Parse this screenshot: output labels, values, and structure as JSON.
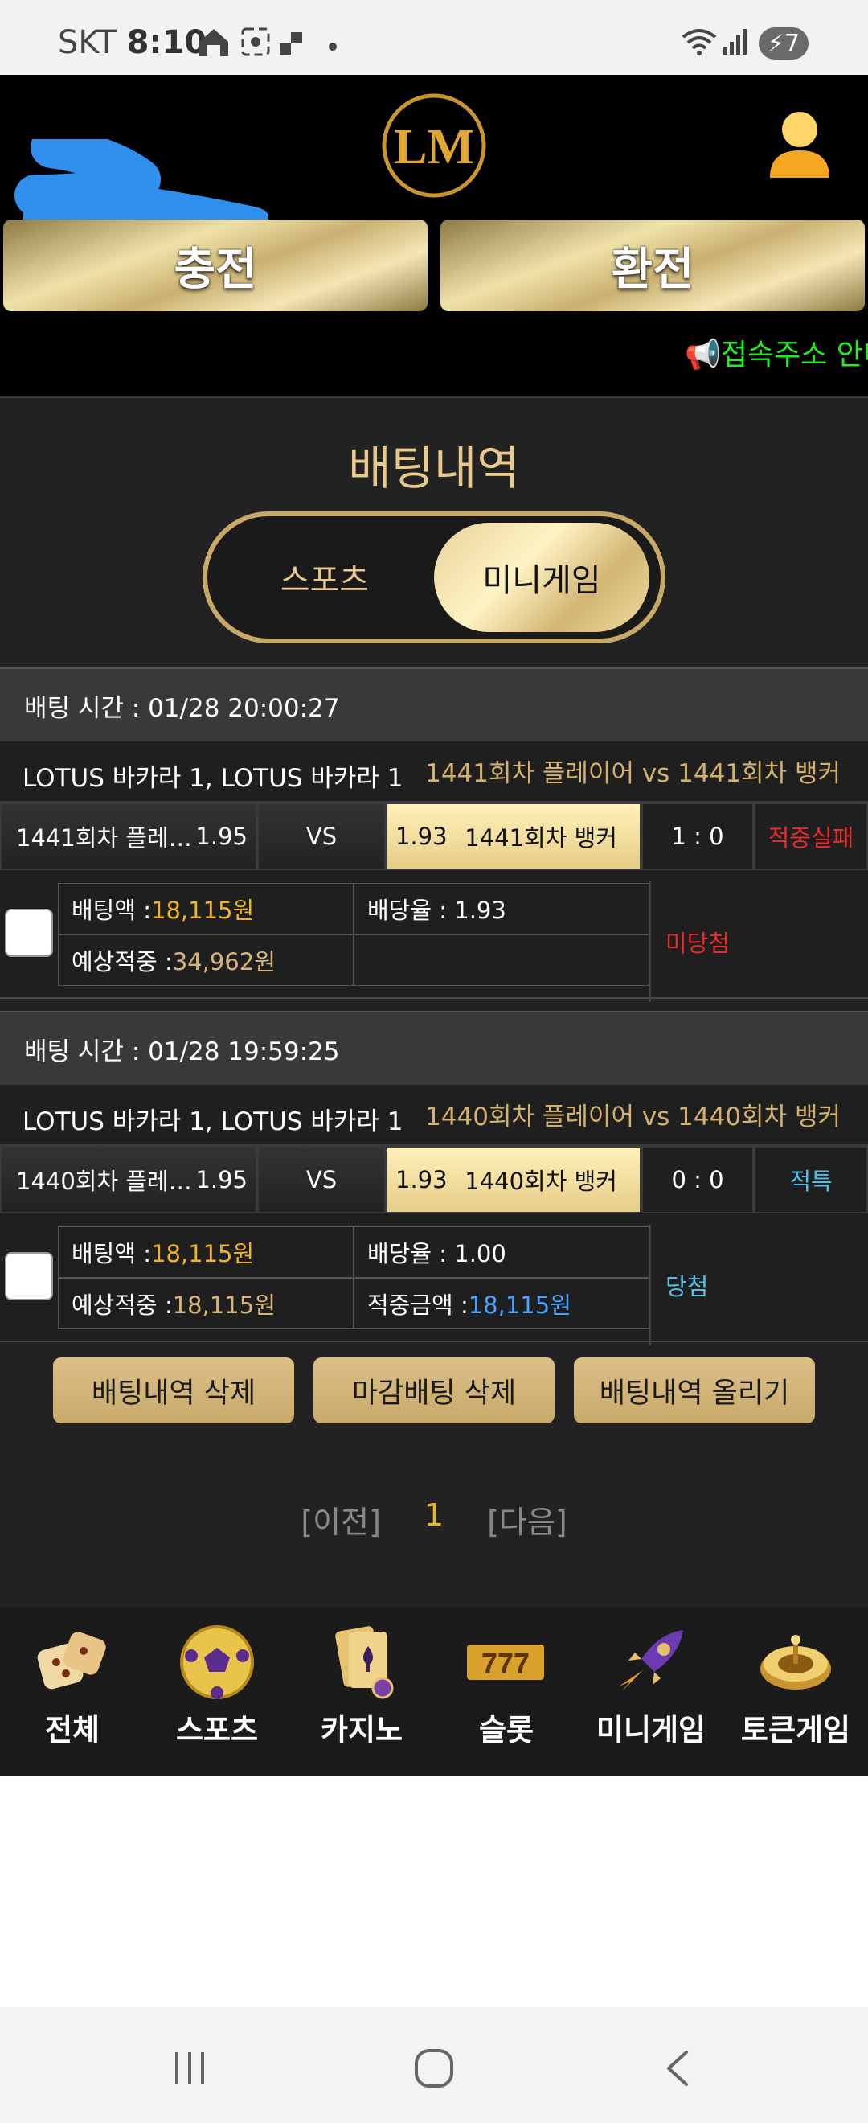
{
  "status_bar": {
    "carrier": "SKT",
    "time": "8:10",
    "battery": "7"
  },
  "header": {
    "logo_text": "LM",
    "charge_label": "충전",
    "exchange_label": "환전",
    "notice_text": "📢접속주소 안내"
  },
  "page": {
    "title": "배팅내역",
    "tabs": [
      {
        "label": "스포츠",
        "active": false
      },
      {
        "label": "미니게임",
        "active": true
      }
    ]
  },
  "bets": [
    {
      "time_label": "배팅 시간 : 01/28 20:00:27",
      "league": "LOTUS 바카라 1, LOTUS 바카라 1",
      "teams": "1441회차 플레이어  vs  1441회차 뱅커",
      "home_name": "1441회차 플레…",
      "home_odd": "1.95",
      "vs": "VS",
      "away_odd": "1.93",
      "away_name": "1441회차 뱅커",
      "score": "1 : 0",
      "result": "적중실패",
      "bet_amount_label": "배팅액 : ",
      "bet_amount": "18,115원",
      "odds_label": "배당율 : 1.93",
      "expected_label": "예상적중 : ",
      "expected": "34,962원",
      "win_amount_label": "",
      "win_amount": "",
      "status": "미당첨"
    },
    {
      "time_label": "배팅 시간 : 01/28 19:59:25",
      "league": "LOTUS 바카라 1, LOTUS 바카라 1",
      "teams": "1440회차 플레이어  vs  1440회차 뱅커",
      "home_name": "1440회차 플레…",
      "home_odd": "1.95",
      "vs": "VS",
      "away_odd": "1.93",
      "away_name": "1440회차 뱅커",
      "score": "0 : 0",
      "result": "적특",
      "bet_amount_label": "배팅액 : ",
      "bet_amount": "18,115원",
      "odds_label": "배당율 : 1.00",
      "expected_label": "예상적중 : ",
      "expected": "18,115원",
      "win_amount_label": "적중금액 : ",
      "win_amount": "18,115원",
      "status": "당첨"
    }
  ],
  "actions": {
    "delete_history": "배팅내역 삭제",
    "delete_closed": "마감배팅 삭제",
    "post_history": "배팅내역 올리기"
  },
  "pager": {
    "prev": "[이전]",
    "current": "1",
    "next": "[다음]"
  },
  "bottom_nav": [
    {
      "label": "전체",
      "icon": "dice-icon"
    },
    {
      "label": "스포츠",
      "icon": "soccer-ball-icon"
    },
    {
      "label": "카지노",
      "icon": "cards-icon"
    },
    {
      "label": "슬롯",
      "icon": "slot-777-icon"
    },
    {
      "label": "미니게임",
      "icon": "rocket-icon"
    },
    {
      "label": "토큰게임",
      "icon": "roulette-icon"
    }
  ],
  "colors": {
    "gold": "#d4b16d",
    "notice_green": "#1df01d",
    "fail_red": "#e52b2b",
    "special_cyan": "#52c0e8"
  }
}
